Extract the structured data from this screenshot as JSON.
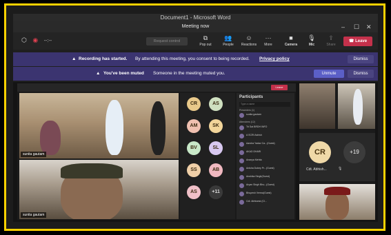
{
  "window": {
    "title": "Document1 - Microsoft Word"
  },
  "meeting": {
    "title": "Meeting now"
  },
  "toolbar": {
    "timer": "--:--",
    "request_control": "Request control",
    "popout": "Pop out",
    "people": "People",
    "reactions": "Reactions",
    "more": "More",
    "camera": "Camera",
    "mic": "Mic",
    "share": "Share",
    "leave": "Leave"
  },
  "banners": {
    "recording_bold": "Recording has started.",
    "recording_text": "By attending this meeting, you consent to being recorded.",
    "privacy": "Privacy policy",
    "dismiss": "Dismiss",
    "muted_bold": "You've been muted",
    "muted_text": "Someone in the meeting muted you.",
    "unmute": "Unmute"
  },
  "shared": {
    "leave": "Leave",
    "participants_title": "Participants",
    "search_placeholder": "Type a name",
    "section_presenters": "Presenters (1)",
    "section_attendees": "Attendees (12)",
    "participants": [
      "sunita gautam",
      "Tri Sat BRDH INFO",
      "A SCRI Ashish",
      "Aarsha Yadav Ca...(Guest)",
      "AKAD DHARI",
      "Ananya Mehta",
      "Anisha Dubey Pr...(Guest)",
      "Anshika Singh(Guest)",
      "Aryan Singh Bhu...(Guest)",
      "Bhupesh Verma(Guest)",
      "Cdt. Abhisesk (Cl..."
    ],
    "avatars": [
      "CR",
      "AS",
      "AM",
      "SK",
      "BV",
      "SL",
      "SS",
      "AB",
      "AS",
      "+11"
    ],
    "tile1_label": "sunita gautam",
    "tile2_label": "sunita gautam"
  },
  "right": {
    "cr": "CR",
    "plus": "+19",
    "cr_name": "Cdt. Abhish..."
  },
  "main_tile": {
    "label": "sunita gautam"
  }
}
